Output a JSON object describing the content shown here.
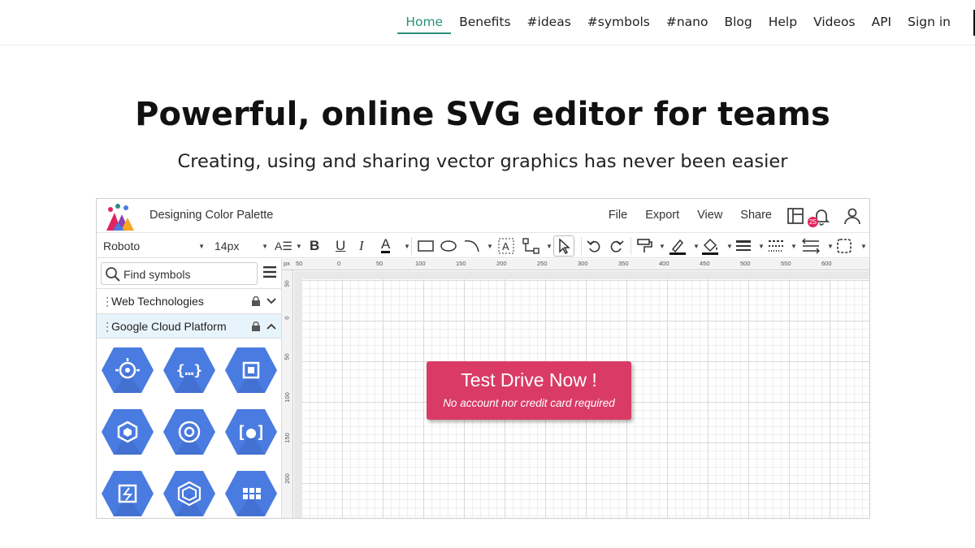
{
  "nav": {
    "items": [
      {
        "label": "Home",
        "active": true
      },
      {
        "label": "Benefits"
      },
      {
        "label": "#ideas"
      },
      {
        "label": "#symbols"
      },
      {
        "label": "#nano"
      },
      {
        "label": "Blog"
      },
      {
        "label": "Help"
      },
      {
        "label": "Videos"
      },
      {
        "label": "API"
      },
      {
        "label": "Sign in"
      }
    ]
  },
  "hero": {
    "title": "Powerful, online SVG editor for teams",
    "subtitle": "Creating, using and sharing vector graphics has never been easier"
  },
  "editor": {
    "doc_title": "Designing Color Palette",
    "menu": [
      "File",
      "Export",
      "View",
      "Share"
    ],
    "notification_count": "25",
    "toolbar": {
      "font_family": "Roboto",
      "font_size": "14px"
    },
    "sidebar": {
      "search_placeholder": "Find symbols",
      "libraries": [
        {
          "label": "Web Technologies",
          "expanded": false
        },
        {
          "label": "Google Cloud Platform",
          "expanded": true
        }
      ],
      "symbol_icons": [
        "endpoints-icon",
        "api-icon",
        "compute-chip-icon",
        "container-icon",
        "shutter-icon",
        "cluster-icon",
        "gpu-icon",
        "layers-icon",
        "grid-icon"
      ]
    },
    "ruler": {
      "unit": "px",
      "top_labels": [
        "50",
        "0",
        "50",
        "100",
        "150",
        "200",
        "250",
        "300",
        "350",
        "400",
        "450",
        "500",
        "550",
        "600"
      ],
      "left_labels": [
        "50",
        "0",
        "50",
        "100",
        "150",
        "200"
      ]
    },
    "cta": {
      "title": "Test Drive Now !",
      "subtitle": "No account nor credit card required"
    }
  },
  "colors": {
    "accent": "#2a8f7a",
    "cta": "#d93b66",
    "gcp_blue": "#4a7be0",
    "selected_row": "#e8f4fb"
  }
}
